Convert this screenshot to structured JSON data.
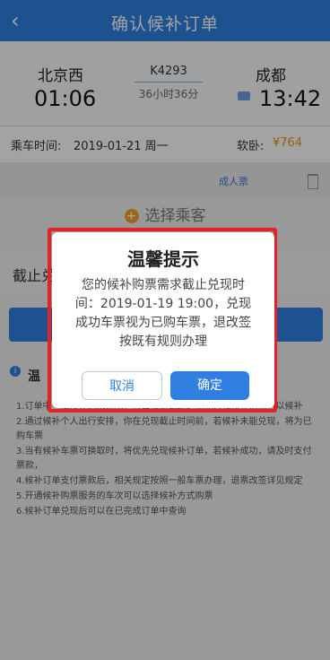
{
  "header": {
    "title": "确认候补订单"
  },
  "train": {
    "from_station": "北京西",
    "to_station": "成都",
    "departure": "01:06",
    "arrival": "13:42",
    "number": "K4293",
    "duration": "36小时36分"
  },
  "trip": {
    "date_label": "乘车时间:",
    "date_value": "2019-01-21 周一",
    "seat_type": "软卧:",
    "price": "¥764"
  },
  "passenger": {
    "ticket_type": "成人票"
  },
  "select_passenger_label": "选择乘客",
  "deadline": {
    "label": "截止兑"
  },
  "notice": {
    "title": "温",
    "lines": [
      "1.订单中一张候补购票需求，将会根据铁路运输能力和候补情况，以候补",
      "2.通过候补个人出行安排，你在兑现截止时间前，若候补未能兑现，将为已购车票",
      "3.当有候补车票可换取时，将优先兑现候补订单，若候补成功，请及时支付票款，",
      "4.候补订单支付票款后，相关规定按照一般车票办理，退票改签详见规定",
      "5.开通候补购票服务的车次可以选择候补方式购票",
      "6.候补订单兑现后可以在已完成订单中查询"
    ]
  },
  "dialog": {
    "title": "温馨提示",
    "message": "您的候补购票需求截止兑现时间：2019-01-19 19:00，兑现成功车票视为已购车票，退改签按既有规则办理",
    "cancel": "取消",
    "confirm": "确定"
  }
}
